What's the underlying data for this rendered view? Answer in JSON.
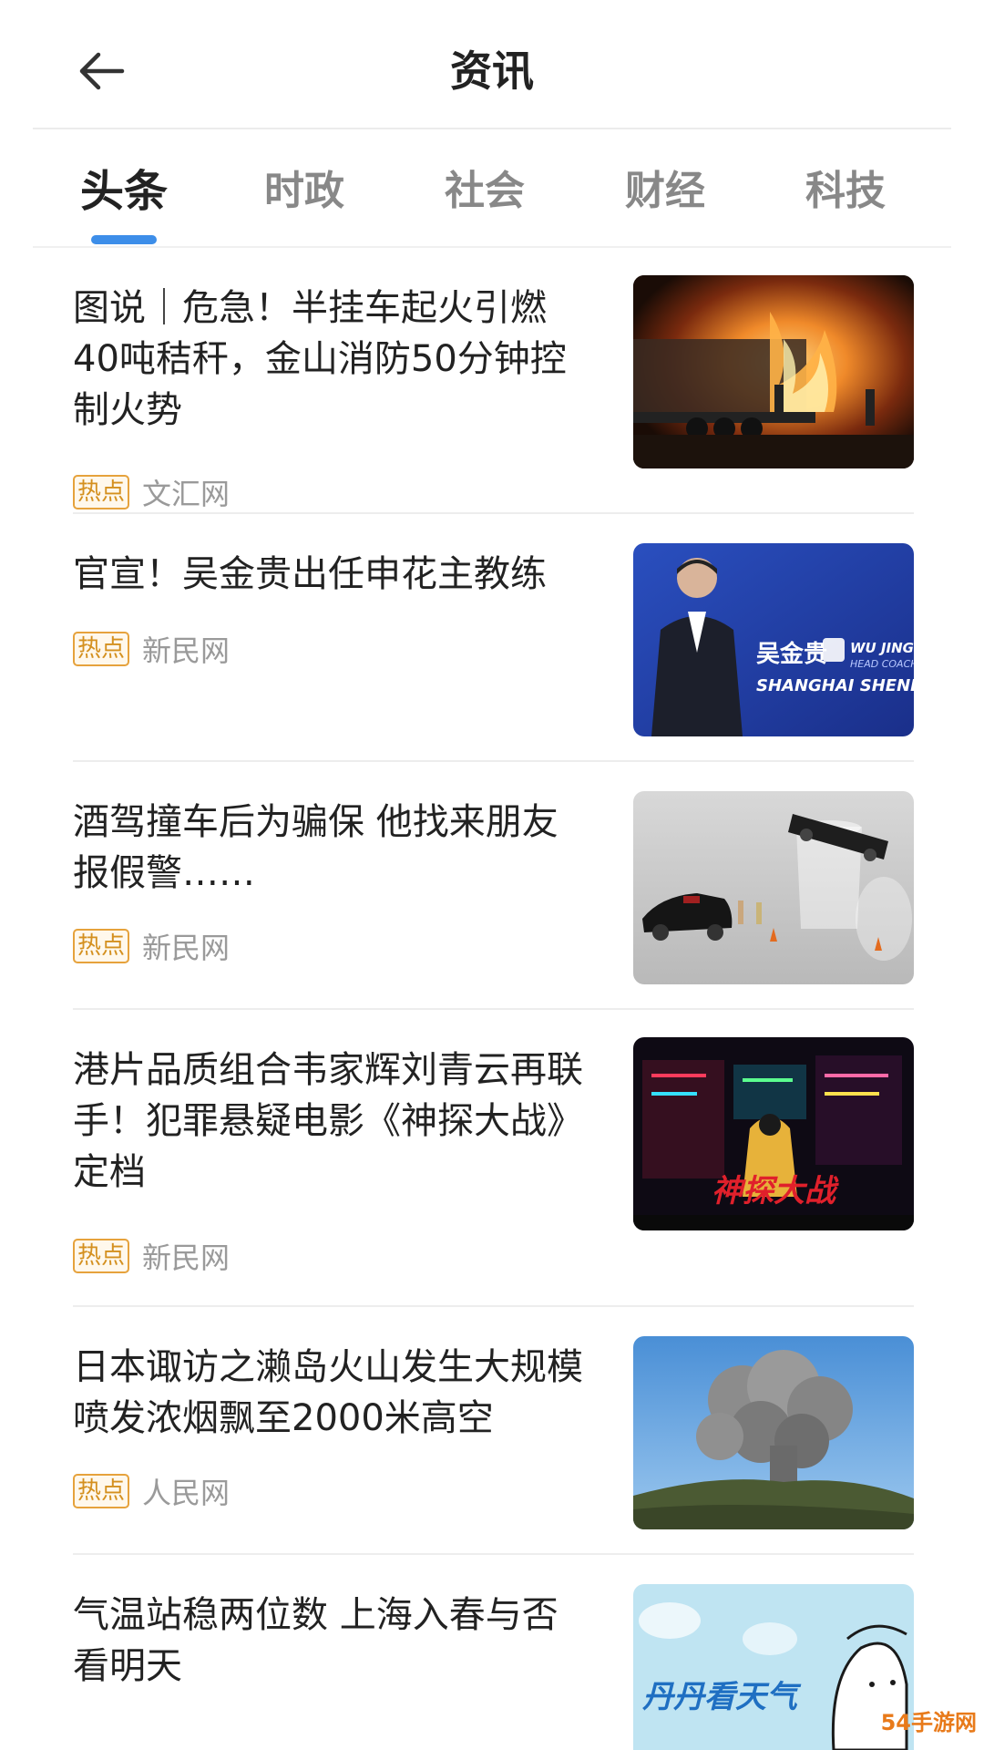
{
  "header": {
    "title": "资讯"
  },
  "tabs": [
    {
      "label": "头条",
      "active": true
    },
    {
      "label": "时政",
      "active": false
    },
    {
      "label": "社会",
      "active": false
    },
    {
      "label": "财经",
      "active": false
    },
    {
      "label": "科技",
      "active": false
    }
  ],
  "news": [
    {
      "title": "图说｜危急！半挂车起火引燃40吨秸秆，金山消防50分钟控制火势",
      "badge": "热点",
      "source": "文汇网",
      "image": "truck-fire-photo"
    },
    {
      "title": "官宣！吴金贵出任申花主教练",
      "badge": "热点",
      "source": "新民网",
      "image": "coach-portrait-photo",
      "image_text": {
        "name_cn": "吴金贵",
        "name_en": "WU JINGUI",
        "role": "HEAD COACH",
        "club": "SHANGHAI SHENHUA"
      }
    },
    {
      "title": "酒驾撞车后为骗保 他找来朋友报假警……",
      "badge": "热点",
      "source": "新民网",
      "image": "toy-car-photo"
    },
    {
      "title": "港片品质组合韦家辉刘青云再联手！犯罪悬疑电影《神探大战》定档",
      "badge": "热点",
      "source": "新民网",
      "image": "movie-poster",
      "image_text": {
        "poster_title": "神探大战"
      }
    },
    {
      "title": "日本诹访之濑岛火山发生大规模喷发浓烟飘至2000米高空",
      "badge": "热点",
      "source": "人民网",
      "image": "volcano-photo"
    },
    {
      "title": "气温站稳两位数 上海入春与否看明天",
      "badge": "",
      "source": "",
      "image": "weather-illustration",
      "image_text": {
        "caption": "丹丹看天气"
      }
    }
  ],
  "watermark": "54手游网",
  "colors": {
    "accent": "#3d8ee9",
    "badge": "#e6a23c",
    "source_text": "#9a9a9a"
  }
}
